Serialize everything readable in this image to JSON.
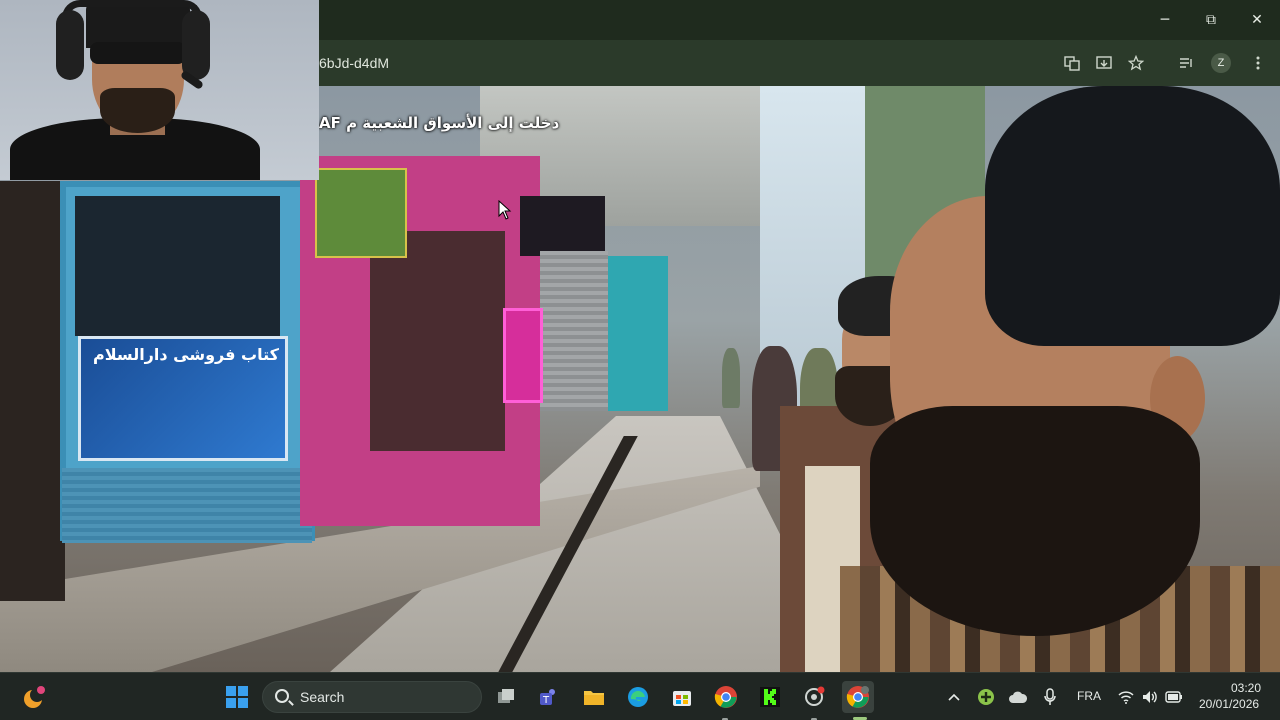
{
  "browser": {
    "url_fragment": "6bJd-d4dM",
    "window_controls": {
      "minimize": "─",
      "maximize": "⧉",
      "close": "✕"
    },
    "profile_initial": "Z"
  },
  "video": {
    "caption": "AF دخلت إلى الأسواق الشعبية م",
    "shop_sign": "کتاب فروشی دارالسلام"
  },
  "taskbar": {
    "search_label": "Search",
    "language": "FRA",
    "time": "03:20",
    "date": "20/01/2026"
  },
  "colors": {
    "titlebar": "#1f2b1e",
    "toolbar": "#2b3a2a",
    "taskbar": "#202623"
  }
}
